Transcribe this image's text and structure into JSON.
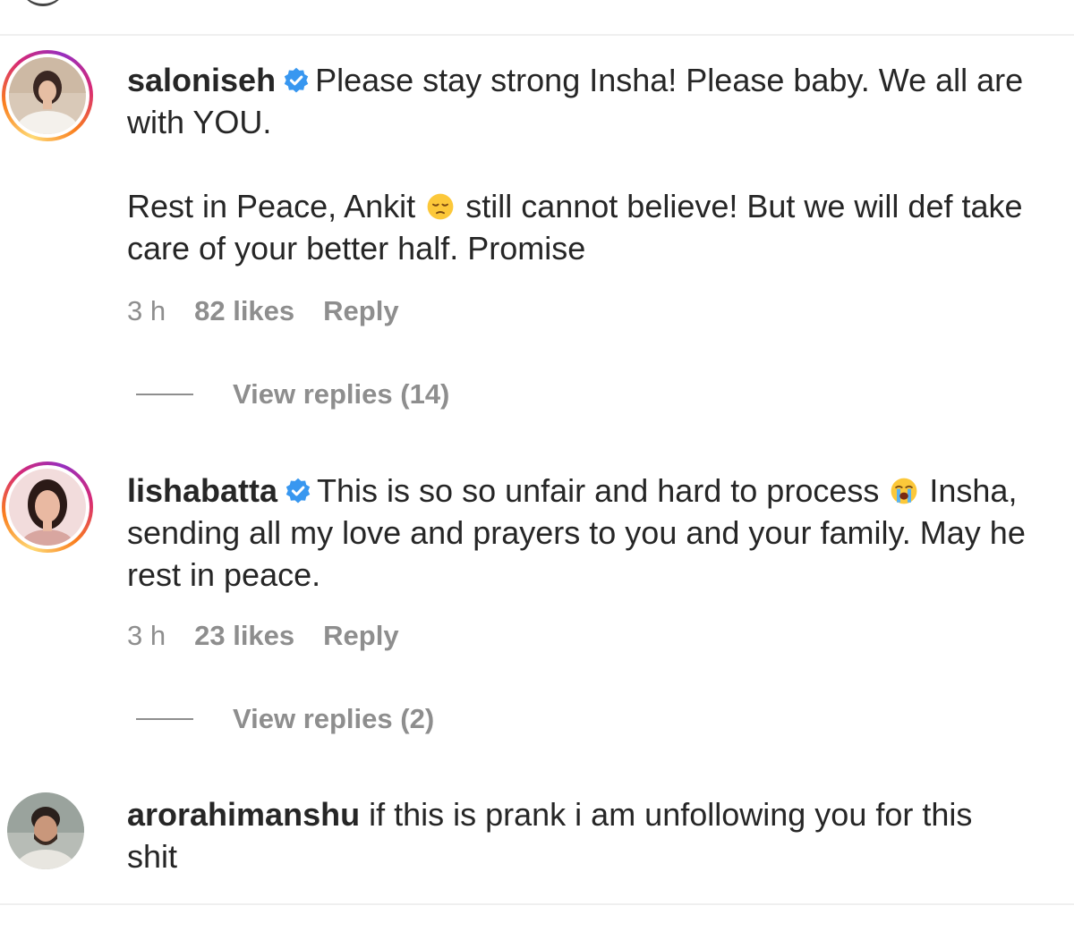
{
  "comments": [
    {
      "username": "saloniseh",
      "verified": true,
      "text_1": "Please stay strong Insha! Please baby. We all are with YOU.",
      "text_2a": "Rest in Peace, Ankit",
      "emoji_1": "pensive-face",
      "text_2b": "still cannot believe! But we will def take care of your better half. Promise",
      "time": "3 h",
      "likes": "82 likes",
      "reply_label": "Reply",
      "view_replies": "View replies (14)"
    },
    {
      "username": "lishabatta",
      "verified": true,
      "text_1": "This is so so unfair and hard to process",
      "emoji_1": "loudly-crying-face",
      "text_2": "Insha, sending all my love and prayers to you and your family. May he rest in peace.",
      "time": "3 h",
      "likes": "23 likes",
      "reply_label": "Reply",
      "view_replies": "View replies (2)"
    },
    {
      "username": "arorahimanshu",
      "verified": false,
      "text_1": "if this is prank i am unfollowing you for this shit"
    }
  ],
  "colors": {
    "text": "#262626",
    "secondary": "#8e8e8e",
    "verified_blue": "#3897f0",
    "divider": "#efefef"
  }
}
